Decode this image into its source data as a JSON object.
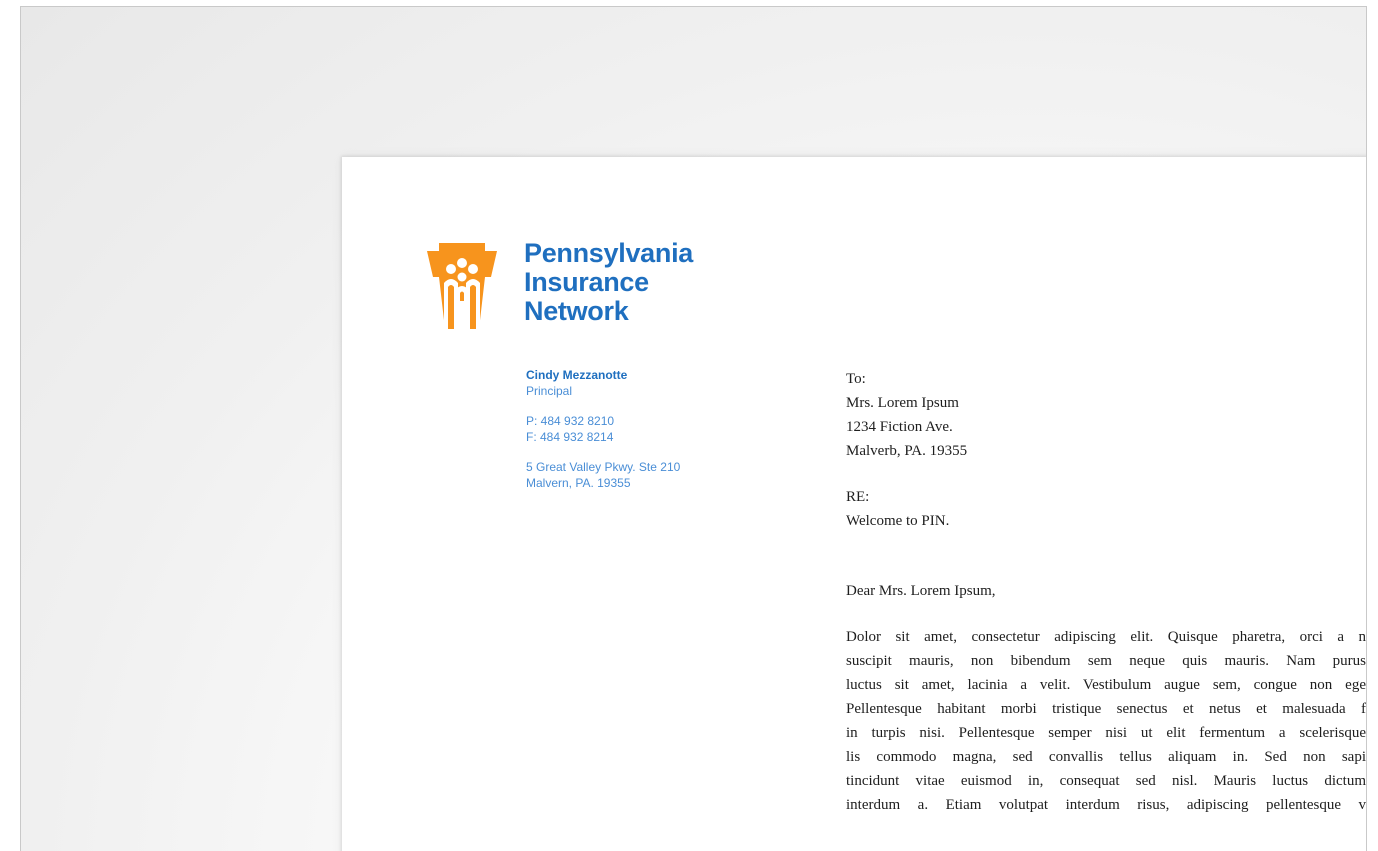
{
  "logo": {
    "icon": "keystone-people-icon",
    "brand_color": "#f7941d",
    "text_color": "#1f6fbf",
    "lines": [
      "Pennsylvania",
      "Insurance",
      "Network"
    ]
  },
  "sender": {
    "name": "Cindy Mezzanotte",
    "title": "Principal",
    "phone": "P: 484 932 8210",
    "fax": "F: 484 932 8214",
    "address_line1": "5 Great Valley Pkwy. Ste 210",
    "address_line2": "Malvern, PA. 19355"
  },
  "recipient": {
    "to_label": "To:",
    "name": "Mrs. Lorem Ipsum",
    "street": "1234 Fiction Ave.",
    "city": "Malverb, PA. 19355"
  },
  "re": {
    "label": "RE:",
    "subject": "Welcome to PIN."
  },
  "salutation": "Dear Mrs. Lorem Ipsum,",
  "body_lines": [
    "Dolor sit amet, consectetur adipiscing elit. Quisque pharetra, orci a n",
    "suscipit mauris, non bibendum sem neque quis mauris. Nam purus",
    "luctus sit amet, lacinia a velit. Vestibulum augue sem, congue non ege",
    "Pellentesque habitant morbi tristique senectus et netus et malesuada f",
    "in turpis nisi. Pellentesque semper nisi ut elit fermentum a scelerisque",
    "lis commodo magna, sed convallis tellus aliquam in. Sed non sapi",
    "tincidunt vitae euismod in, consequat sed nisl. Mauris luctus dictum",
    "interdum a. Etiam volutpat interdum risus, adipiscing pellentesque v"
  ]
}
